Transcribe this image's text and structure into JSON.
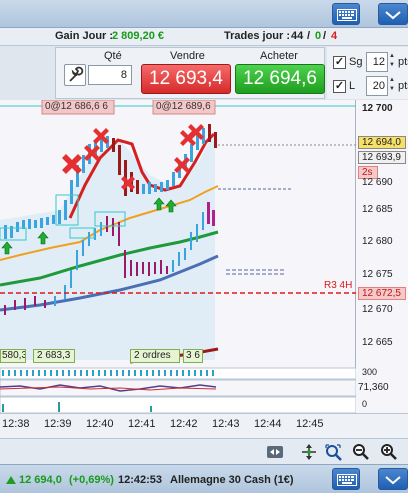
{
  "header": {
    "gain_label": "Gain Jour :",
    "gain_value": "2 809,20 €",
    "trades_label": "Trades jour :",
    "trades_total": "44",
    "trades_sep1": "/",
    "trades_win": "0",
    "trades_sep2": "/",
    "trades_loss": "4"
  },
  "order_panel": {
    "qty_label": "Qté",
    "qty_value": "8",
    "sell_label": "Vendre",
    "sell_price": "12 693,4",
    "buy_label": "Acheter",
    "buy_price": "12 694,6"
  },
  "options": {
    "sg_label": "Sg",
    "sg_value": "12",
    "sg_unit": "pts",
    "l_label": "L",
    "l_value": "20",
    "l_unit": "pts"
  },
  "chart": {
    "order_tag_left": "0@12 686,6  6",
    "order_tag_right": "0@12 689,6",
    "label_r3": "R3 4H",
    "label_countdown": "2s",
    "label_box1": "580,3",
    "label_box2": "2 683,3",
    "label_orders": "2 ordres",
    "label_orders_qty": "3 6",
    "indicator_top_value": "300",
    "indicator_mid_value": "71,360",
    "indicator_bot_value": "0"
  },
  "price_axis": {
    "ticks": [
      "12 700",
      "12 690",
      "12 685",
      "12 680",
      "12 675",
      "12 670",
      "12 665"
    ],
    "box_ask": "12 694,0",
    "box_bid": "12 693,9",
    "box_r3": "12 672,5"
  },
  "time_axis": {
    "ticks": [
      "12:38",
      "12:39",
      "12:40",
      "12:41",
      "12:42",
      "12:43",
      "12:44",
      "12:45"
    ]
  },
  "status": {
    "price": "12 694,0",
    "change": "(+0,69%)",
    "time": "12:42:53",
    "instrument": "Allemagne 30 Cash (1€)"
  },
  "colors": {
    "sell": "#d62a2a",
    "buy": "#1e9e1e",
    "ma_orange": "#f0a020",
    "ma_green": "#1f9a3a",
    "ma_blue": "#4a6fb5",
    "r3_line": "#e01818"
  },
  "icons": [
    "keyboard-icon",
    "wrench-icon",
    "check-icon",
    "arrow-up-icon",
    "cross-icon",
    "zoom-in-icon",
    "zoom-out-icon",
    "magnifier-icon",
    "scroll-icon",
    "move-icon"
  ]
}
